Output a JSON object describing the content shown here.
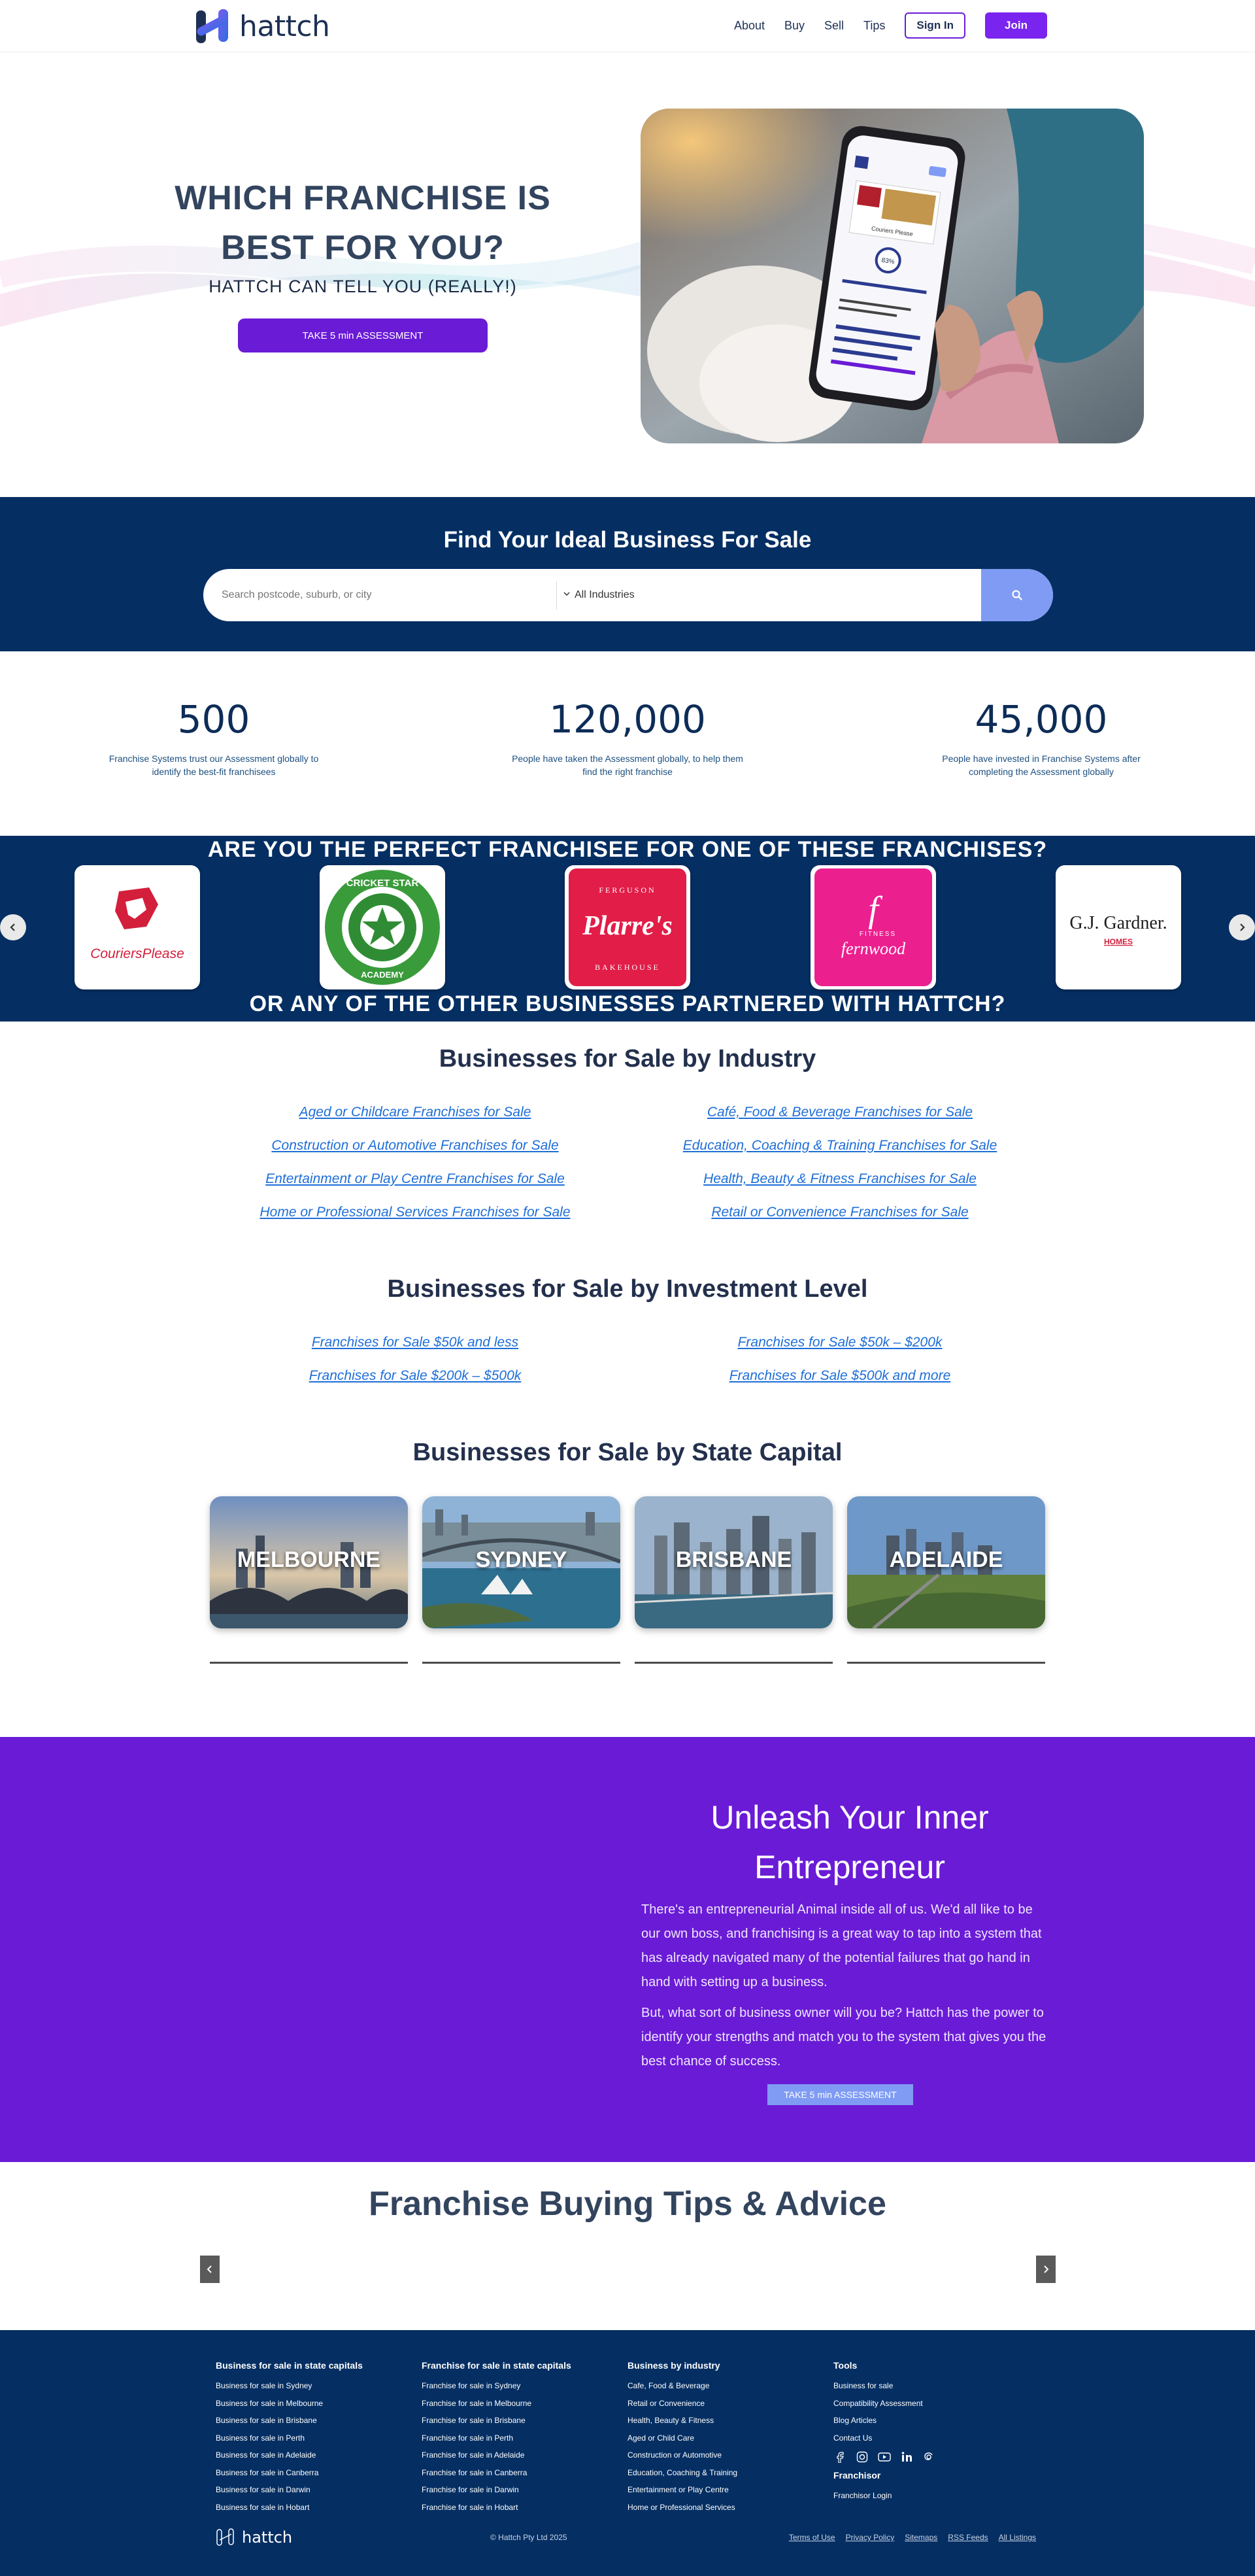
{
  "header": {
    "logo_text": "hattch",
    "nav": [
      "About",
      "Buy",
      "Sell",
      "Tips"
    ],
    "signin": "Sign In",
    "join": "Join"
  },
  "hero": {
    "title_line1": "WHICH FRANCHISE IS",
    "title_line2": "BEST FOR YOU?",
    "subtitle": "HATTCH CAN TELL YOU (REALLY!)",
    "button": "TAKE 5 min ASSESSMENT",
    "phone_brand": "Couriers Please",
    "phone_score": "83%"
  },
  "search": {
    "title": "Find Your Ideal Business For Sale",
    "placeholder": "Search postcode, suburb, or city",
    "industry": "All Industries"
  },
  "stats": [
    {
      "num": "500",
      "desc": "Franchise Systems trust our Assessment globally to identify the best-fit franchisees"
    },
    {
      "num": "120,000",
      "desc": "People have taken the Assessment globally, to help them find the right franchise"
    },
    {
      "num": "45,000",
      "desc": "People have invested in Franchise Systems after completing the Assessment globally"
    }
  ],
  "franchises": {
    "title1": "ARE YOU THE PERFECT FRANCHISEE FOR ONE OF THESE FRANCHISES?",
    "title2": "OR ANY OF THE OTHER BUSINESSES PARTNERED WITH HATTCH?",
    "brands": [
      "CouriersPlease",
      "CRICKET STAR",
      "ACADEMY",
      "FERGUSON",
      "Plarre's",
      "BAKEHOUSE",
      "f",
      "fernwood",
      "FITNESS",
      "G.J. Gardner.",
      "HOMES"
    ]
  },
  "industry": {
    "title": "Businesses for Sale by Industry",
    "left": [
      "Aged or Childcare Franchises for Sale",
      "Construction or Automotive Franchises for Sale",
      "Entertainment or Play Centre Franchises for Sale",
      "Home or Professional Services Franchises for Sale"
    ],
    "right": [
      "Café, Food & Beverage Franchises for Sale",
      "Education, Coaching & Training Franchises for Sale",
      "Health, Beauty & Fitness Franchises for Sale",
      "Retail or Convenience Franchises for Sale"
    ]
  },
  "investment": {
    "title": "Businesses for Sale by Investment Level",
    "left": [
      "Franchises for Sale $50k and less",
      "Franchises for Sale $200k – $500k"
    ],
    "right": [
      "Franchises for Sale $50k – $200k",
      "Franchises for Sale $500k and more"
    ]
  },
  "cities": {
    "title": "Businesses for Sale by State Capital",
    "items": [
      "MELBOURNE",
      "SYDNEY",
      "BRISBANE",
      "ADELAIDE"
    ]
  },
  "purple": {
    "title_line1": "Unleash Your Inner",
    "title_line2": "Entrepreneur",
    "p1": "There's an entrepreneurial Animal inside all of us. We'd all like to be our own boss, and franchising is a great way to tap into a system that has already navigated many of the potential failures that go hand in hand with setting up a business.",
    "p2": "But, what sort of business owner will you be? Hattch has the power to identify your strengths and match you to the system that gives you the best chance of success.",
    "button": "TAKE 5 min ASSESSMENT"
  },
  "tips": {
    "title": "Franchise Buying Tips & Advice"
  },
  "footer": {
    "col1": {
      "title": "Business for sale in state capitals",
      "links": [
        "Business for sale in Sydney",
        "Business for sale in Melbourne",
        "Business for sale in Brisbane",
        "Business for sale in Perth",
        "Business for sale in Adelaide",
        "Business for sale in Canberra",
        "Business for sale in Darwin",
        "Business for sale in Hobart"
      ]
    },
    "col2": {
      "title": "Franchise for sale in state capitals",
      "links": [
        "Franchise for sale in Sydney",
        "Franchise for sale in Melbourne",
        "Franchise for sale in Brisbane",
        "Franchise for sale in Perth",
        "Franchise for sale in Adelaide",
        "Franchise for sale in Canberra",
        "Franchise for sale in Darwin",
        "Franchise for sale in Hobart"
      ]
    },
    "col3": {
      "title": "Business by industry",
      "links": [
        "Cafe, Food & Beverage",
        "Retail or Convenience",
        "Health, Beauty & Fitness",
        "Aged or Child Care",
        "Construction or Automotive",
        "Education, Coaching & Training",
        "Entertainment or Play Centre",
        "Home or Professional Services"
      ]
    },
    "col4": {
      "title": "Tools",
      "links": [
        "Business for sale",
        "Compatibility Assessment",
        "Blog Articles",
        "Contact Us"
      ],
      "franchisor_title": "Franchisor",
      "franchisor_link": "Franchisor Login"
    },
    "logo_text": "hattch",
    "copyright": "© Hattch Pty Ltd 2025",
    "bottom_links": [
      "Terms of Use",
      "Privacy Policy",
      "Sitemaps",
      "RSS Feeds",
      "All Listings"
    ]
  },
  "colors": {
    "navy": "#052f63",
    "purple": "#6a1bd6",
    "blue_link": "#1e6ed8",
    "search_button": "#7f9bf3"
  }
}
